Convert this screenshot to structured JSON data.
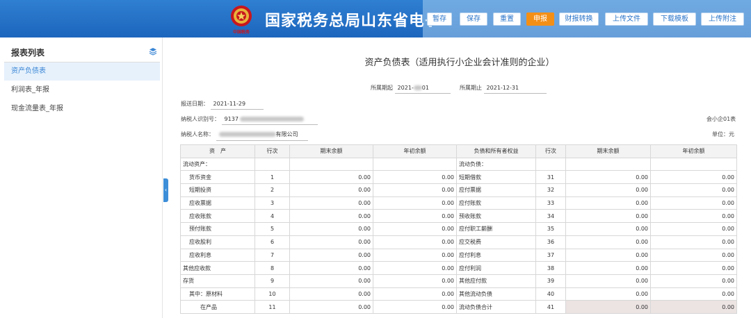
{
  "header": {
    "title": "国家税务总局山东省电子税",
    "emblem_caption": "中国税务"
  },
  "toolbar": {
    "buttons": [
      "暂存",
      "保存",
      "重置",
      "申报",
      "财报转换",
      "上传文件",
      "下载模板",
      "上传附注"
    ],
    "primary_index": 3,
    "primary_color": "#f48f16"
  },
  "sidebar": {
    "title": "报表列表",
    "items": [
      {
        "label": "资产负债表",
        "active": true
      },
      {
        "label": "利润表_年报",
        "active": false
      },
      {
        "label": "现金流量表_年报",
        "active": false
      }
    ]
  },
  "doc": {
    "title": "资产负债表（适用执行小企业会计准则的企业）",
    "period_start_label": "所属期起",
    "period_start_prefix": "2021-",
    "period_start_suffix": "01",
    "period_end_label": "所属期止",
    "period_end": "2021-12-31",
    "report_date_label": "报送日期：",
    "report_date": "2021-11-29",
    "taxpayer_id_label": "纳税人识别号：",
    "taxpayer_id_prefix": "9137",
    "taxpayer_name_label": "纳税人名称：",
    "taxpayer_name_suffix": "有限公司",
    "form_code": "会小企01表",
    "unit": "单位：元"
  },
  "table": {
    "headers": [
      "资　产",
      "行次",
      "期末余额",
      "年初余额",
      "负债和所有者权益",
      "行次",
      "期末余额",
      "年初余额"
    ],
    "rows": [
      {
        "asset": "流动资产：",
        "a_indent": 0,
        "a_line": "",
        "a_end": "",
        "a_begin": "",
        "liab": "流动负债：",
        "l_line": "",
        "l_end": "",
        "l_begin": "",
        "l_ro": false
      },
      {
        "asset": "货币资金",
        "a_indent": 1,
        "a_line": "1",
        "a_end": "0.00",
        "a_begin": "0.00",
        "liab": "短期借款",
        "l_line": "31",
        "l_end": "0.00",
        "l_begin": "0.00",
        "l_ro": false
      },
      {
        "asset": "短期投资",
        "a_indent": 1,
        "a_line": "2",
        "a_end": "0.00",
        "a_begin": "0.00",
        "liab": "应付票据",
        "l_line": "32",
        "l_end": "0.00",
        "l_begin": "0.00",
        "l_ro": false
      },
      {
        "asset": "应收票据",
        "a_indent": 1,
        "a_line": "3",
        "a_end": "0.00",
        "a_begin": "0.00",
        "liab": "应付账款",
        "l_line": "33",
        "l_end": "0.00",
        "l_begin": "0.00",
        "l_ro": false
      },
      {
        "asset": "应收账款",
        "a_indent": 1,
        "a_line": "4",
        "a_end": "0.00",
        "a_begin": "0.00",
        "liab": "预收账款",
        "l_line": "34",
        "l_end": "0.00",
        "l_begin": "0.00",
        "l_ro": false
      },
      {
        "asset": "预付账款",
        "a_indent": 1,
        "a_line": "5",
        "a_end": "0.00",
        "a_begin": "0.00",
        "liab": "应付职工薪酬",
        "l_line": "35",
        "l_end": "0.00",
        "l_begin": "0.00",
        "l_ro": false
      },
      {
        "asset": "应收股利",
        "a_indent": 1,
        "a_line": "6",
        "a_end": "0.00",
        "a_begin": "0.00",
        "liab": "应交税费",
        "l_line": "36",
        "l_end": "0.00",
        "l_begin": "0.00",
        "l_ro": false
      },
      {
        "asset": "应收利息",
        "a_indent": 1,
        "a_line": "7",
        "a_end": "0.00",
        "a_begin": "0.00",
        "liab": "应付利息",
        "l_line": "37",
        "l_end": "0.00",
        "l_begin": "0.00",
        "l_ro": false
      },
      {
        "asset": "其他应收款",
        "a_indent": 0,
        "a_line": "8",
        "a_end": "0.00",
        "a_begin": "0.00",
        "liab": "应付利润",
        "l_line": "38",
        "l_end": "0.00",
        "l_begin": "0.00",
        "l_ro": false
      },
      {
        "asset": "存货",
        "a_indent": 0,
        "a_line": "9",
        "a_end": "0.00",
        "a_begin": "0.00",
        "liab": "其他应付款",
        "l_line": "39",
        "l_end": "0.00",
        "l_begin": "0.00",
        "l_ro": false
      },
      {
        "asset": "其中：原材料",
        "a_indent": 1,
        "a_line": "10",
        "a_end": "0.00",
        "a_begin": "0.00",
        "liab": "其他流动负债",
        "l_line": "40",
        "l_end": "0.00",
        "l_begin": "0.00",
        "l_ro": false
      },
      {
        "asset": "在产品",
        "a_indent": 2,
        "a_line": "11",
        "a_end": "0.00",
        "a_begin": "0.00",
        "liab": "流动负债合计",
        "l_line": "41",
        "l_end": "0.00",
        "l_begin": "0.00",
        "l_ro": true
      }
    ]
  }
}
